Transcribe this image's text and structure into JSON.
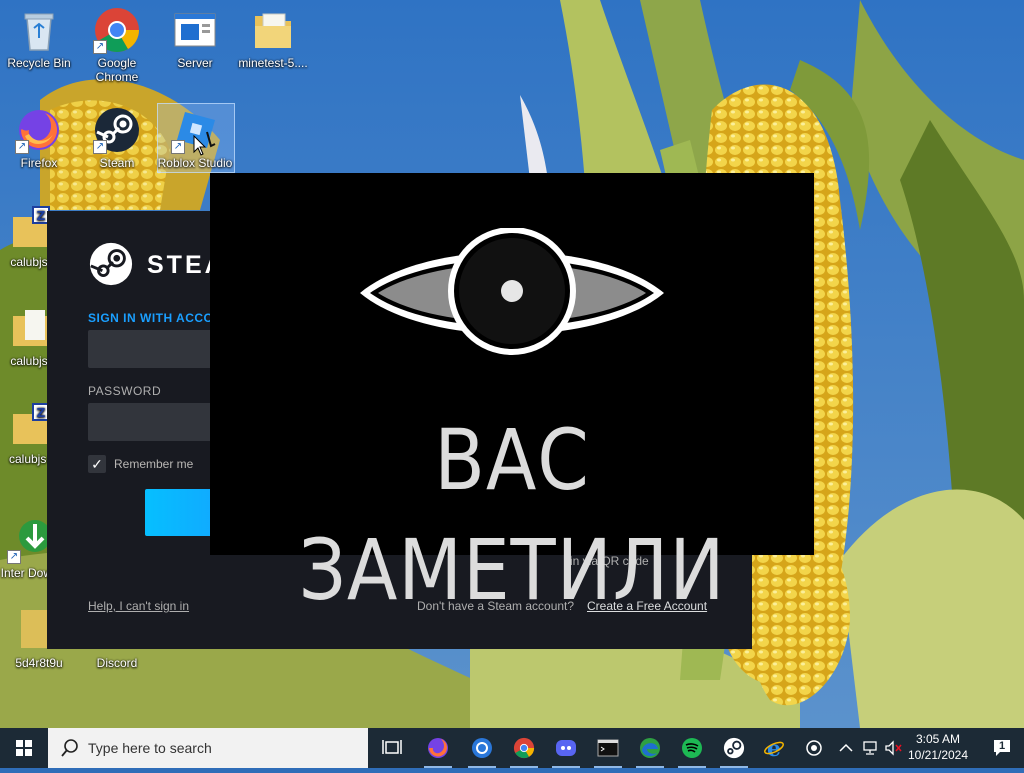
{
  "desktop": {
    "icons": [
      {
        "label": "Recycle Bin"
      },
      {
        "label": "Google Chrome"
      },
      {
        "label": "Server"
      },
      {
        "label": "minetest-5...."
      },
      {
        "label": "Firefox"
      },
      {
        "label": "Steam"
      },
      {
        "label": "Roblox Studio"
      },
      {
        "label": "calubjs-"
      },
      {
        "label": "calubjs-"
      },
      {
        "label": "calubjs-i"
      },
      {
        "label": "Inter Downl"
      },
      {
        "label": "5d4r8t9u"
      },
      {
        "label": "Discord"
      }
    ]
  },
  "steam_window": {
    "brand": "STEA",
    "signin_label": "SIGN IN WITH ACCOU",
    "password_label": "PASSWORD",
    "remember_label": "Remember me",
    "check_mark": "✓",
    "qr_text": "in via QR code",
    "help_link": "Help, I can't sign in",
    "no_account_text": "Don't have a Steam account?",
    "create_link": "Create a Free Account"
  },
  "overlay": {
    "message": "ВАС ЗАМЕТИЛИ"
  },
  "taskbar": {
    "search_placeholder": "Type here to search",
    "time": "3:05 AM",
    "date": "10/21/2024",
    "notification_count": "1"
  },
  "colors": {
    "steam_bg": "#181a21",
    "steam_accent": "#1a9fff",
    "taskbar_bg": "#1c2a36"
  }
}
